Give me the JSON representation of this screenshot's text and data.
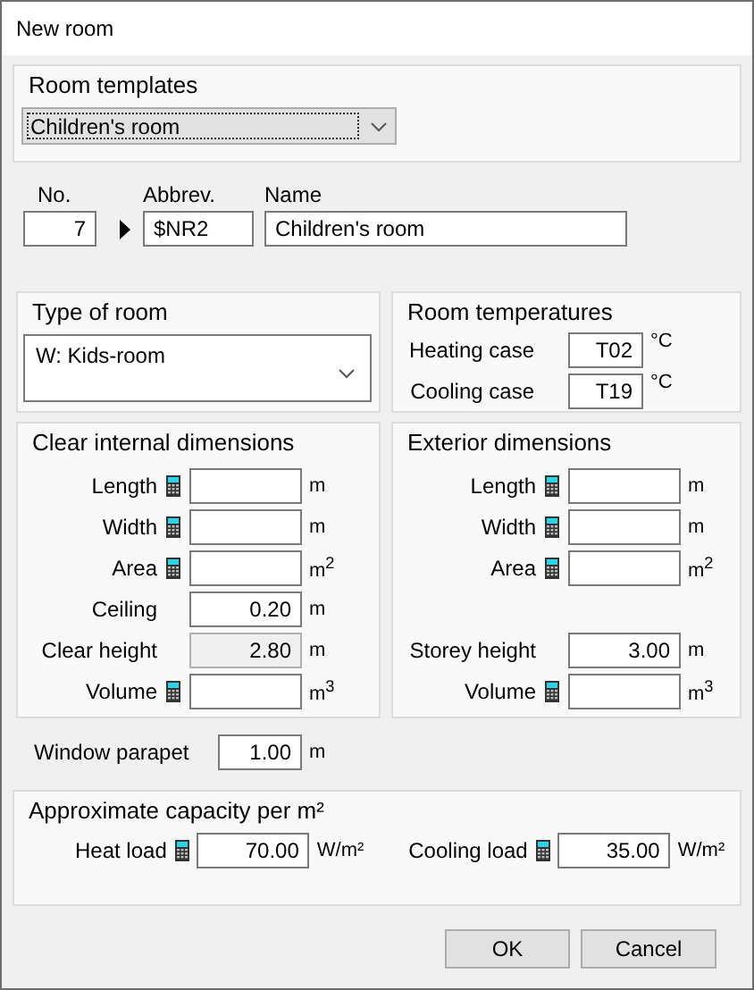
{
  "window": {
    "title": "New room"
  },
  "room_templates": {
    "title": "Room templates",
    "value": "Children's room",
    "focused": true
  },
  "identity": [
    {
      "label": "No.",
      "value": "7"
    },
    {
      "label": "Abbrev.",
      "value": "$NR2"
    },
    {
      "label": "Name",
      "value": "Children's room"
    }
  ],
  "type_of_room": {
    "title": "Type of room",
    "value": "W: Kids-room"
  },
  "room_temperatures": {
    "title": "Room temperatures",
    "rows": [
      {
        "label": "Heating case",
        "value": "T02",
        "unit": "°C"
      },
      {
        "label": "Cooling case",
        "value": "T19",
        "unit": "°C"
      }
    ]
  },
  "clear_internal_dimensions": {
    "title": "Clear internal dimensions",
    "rows": [
      {
        "label": "Length",
        "kind": "calc",
        "unit": "m"
      },
      {
        "label": "Width",
        "kind": "calc",
        "unit": "m"
      },
      {
        "label": "Area",
        "kind": "calc",
        "unit": "m$^{2}$"
      },
      {
        "label": "Ceiling",
        "kind": "plain",
        "value": "0.20",
        "unit": "m"
      },
      {
        "label": "Clear height",
        "kind": "readonly",
        "value": "2.80",
        "unit": "m"
      },
      {
        "label": "Volume",
        "kind": "calc",
        "unit": "m$^{3}$"
      }
    ]
  },
  "exterior_dimensions": {
    "title": "Exterior dimensions",
    "rows": [
      {
        "label": "Length",
        "kind": "calc",
        "unit": "m"
      },
      {
        "label": "Width",
        "kind": "calc",
        "unit": "m"
      },
      {
        "label": "Area",
        "kind": "calc",
        "unit": "m$^{2}$"
      },
      {
        "label": "Storey height",
        "kind": "plain",
        "value": "3.00",
        "unit": "m",
        "gap_before": true
      },
      {
        "label": "Volume",
        "kind": "calc",
        "unit": "m$^{3}$"
      }
    ]
  },
  "window_parapet": {
    "label": "Window parapet",
    "value": "1.00",
    "unit": "m"
  },
  "approximate_capacity": {
    "title": "Approximate capacity per m²",
    "fields": [
      {
        "label": "Heat load",
        "kind": "calc",
        "value": "70.00",
        "unit": "W/m²"
      },
      {
        "label": "Cooling load",
        "kind": "calc",
        "value": "35.00",
        "unit": "W/m²"
      }
    ]
  },
  "buttons": [
    "OK",
    "Cancel"
  ]
}
